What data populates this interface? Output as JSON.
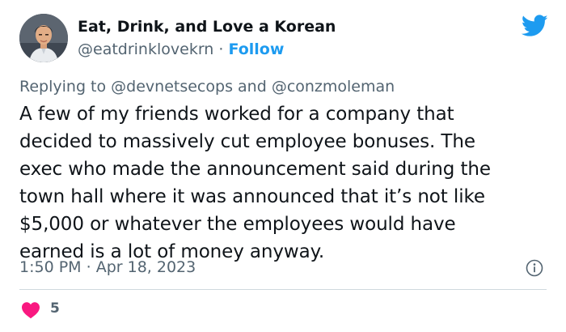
{
  "author": {
    "name": "Eat, Drink, and Love a Korean",
    "handle": "@eatdrinklovekrn",
    "separator": "·",
    "follow_label": "Follow"
  },
  "reply": {
    "prefix": "Replying to",
    "user1": "@devnetsecops",
    "joiner": "and",
    "user2": "@conzmoleman"
  },
  "tweet": {
    "lines": [
      "A few of my friends worked for a company that",
      "decided to massively cut employee bonuses. The",
      "exec who made the announcement said during the",
      "town hall where it was announced that it’s not like",
      "$5,000 or whatever the employees would have",
      "earned is a lot of money anyway."
    ],
    "time": "1:50 PM",
    "date_separator": "·",
    "date": "Apr 18, 2023"
  },
  "engagement": {
    "likes": "5"
  },
  "icons": {
    "brand": "twitter-bird-icon",
    "info": "info-icon",
    "like": "heart-icon"
  },
  "colors": {
    "accent": "#1d9bf0",
    "heart": "#f91880",
    "secondary_text": "#536471",
    "primary_text": "#0f1419"
  }
}
